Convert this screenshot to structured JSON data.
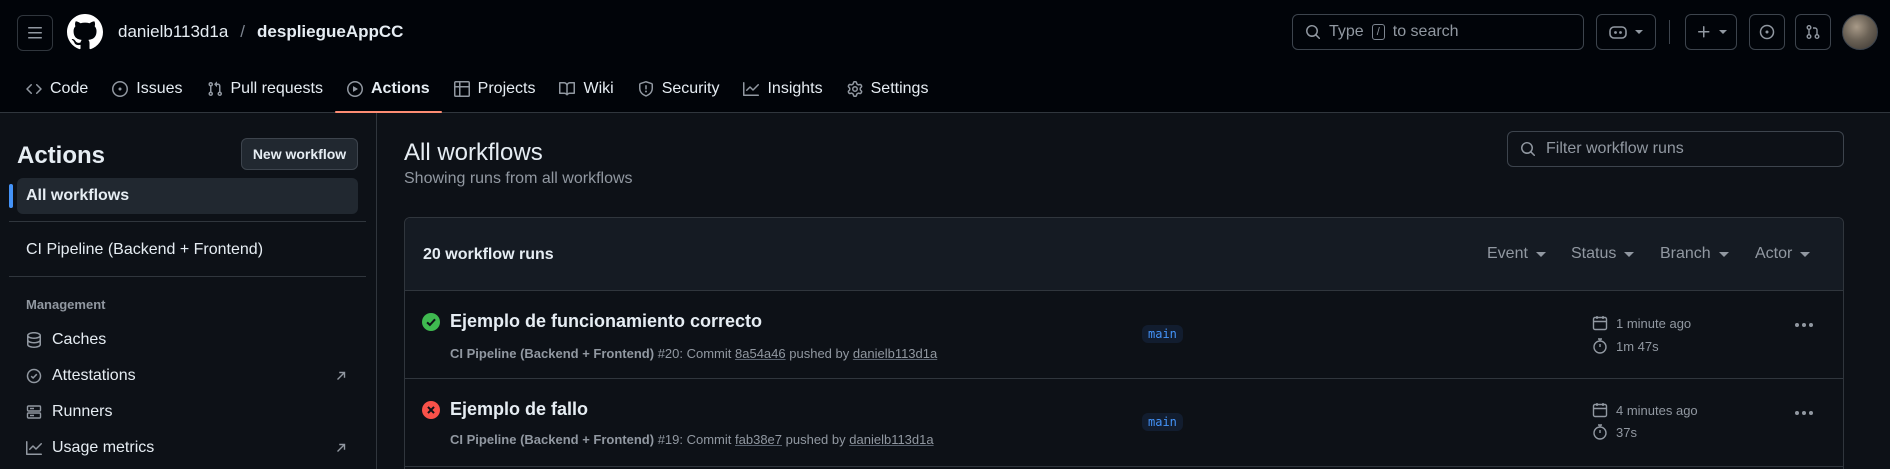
{
  "header": {
    "owner": "danielb113d1a",
    "separator": "/",
    "repo": "despliegueAppCC",
    "search_prefix": "Type",
    "search_key": "/",
    "search_suffix": "to search"
  },
  "tabs": [
    {
      "label": "Code",
      "icon": "code-icon"
    },
    {
      "label": "Issues",
      "icon": "issue-opened-icon"
    },
    {
      "label": "Pull requests",
      "icon": "git-pull-request-icon"
    },
    {
      "label": "Actions",
      "icon": "play-icon",
      "active": true
    },
    {
      "label": "Projects",
      "icon": "table-icon"
    },
    {
      "label": "Wiki",
      "icon": "book-icon"
    },
    {
      "label": "Security",
      "icon": "shield-icon"
    },
    {
      "label": "Insights",
      "icon": "graph-icon"
    },
    {
      "label": "Settings",
      "icon": "gear-icon"
    }
  ],
  "sidebar": {
    "title": "Actions",
    "new_workflow": "New workflow",
    "all_workflows": "All workflows",
    "workflow": "CI Pipeline (Backend + Frontend)",
    "management_heading": "Management",
    "links": [
      {
        "label": "Caches",
        "icon": "database-icon"
      },
      {
        "label": "Attestations",
        "icon": "verified-icon",
        "external": true
      },
      {
        "label": "Runners",
        "icon": "server-icon"
      },
      {
        "label": "Usage metrics",
        "icon": "graph-icon",
        "external": true
      }
    ]
  },
  "main": {
    "title": "All workflows",
    "subtitle": "Showing runs from all workflows",
    "filter_placeholder": "Filter workflow runs",
    "runs_count": "20 workflow runs",
    "filters": [
      "Event",
      "Status",
      "Branch",
      "Actor"
    ],
    "runs": [
      {
        "status": "success",
        "title": "Ejemplo de funcionamiento correcto",
        "workflow": "CI Pipeline (Backend + Frontend)",
        "number": "#20",
        "commit_prefix": ": Commit",
        "commit": "8a54a46",
        "pushed_by": "pushed by",
        "actor": "danielb113d1a",
        "branch": "main",
        "when": "1 minute ago",
        "duration": "1m 47s"
      },
      {
        "status": "failure",
        "title": "Ejemplo de fallo",
        "workflow": "CI Pipeline (Backend + Frontend)",
        "number": "#19",
        "commit_prefix": ": Commit",
        "commit": "fab38e7",
        "pushed_by": "pushed by",
        "actor": "danielb113d1a",
        "branch": "main",
        "when": "4 minutes ago",
        "duration": "37s"
      }
    ]
  },
  "colors": {
    "background": "#0d1117",
    "header": "#010409",
    "accent_tab": "#fd8c73",
    "success": "#3fb950",
    "failure": "#f85149",
    "link": "#4493f8"
  }
}
